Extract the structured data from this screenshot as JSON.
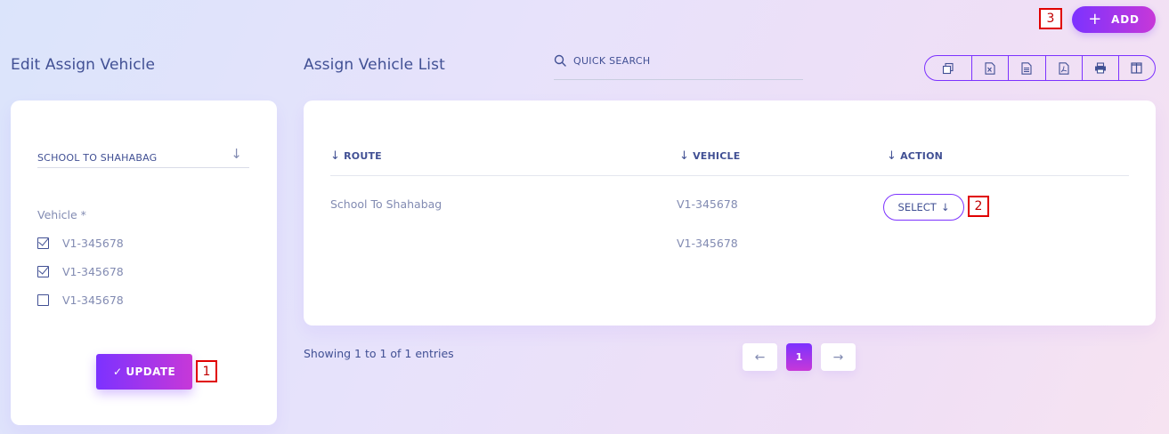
{
  "header": {
    "add_label": "ADD",
    "add_icon": "plus-icon",
    "marker_add": "3"
  },
  "left_panel": {
    "title": "Edit Assign Vehicle",
    "route_value": "SCHOOL TO SHAHABAG",
    "vehicle_label": "Vehicle *",
    "vehicles": [
      {
        "label": "V1-345678",
        "checked": true
      },
      {
        "label": "V1-345678",
        "checked": true
      },
      {
        "label": "V1-345678",
        "checked": false
      }
    ],
    "update_label": "UPDATE",
    "marker_update": "1"
  },
  "list": {
    "title": "Assign Vehicle List",
    "search_placeholder": "QUICK SEARCH",
    "toolbar_icons": [
      "copy-icon",
      "excel-icon",
      "csv-icon",
      "pdf-icon",
      "print-icon",
      "columns-icon"
    ],
    "columns": [
      "ROUTE",
      "VEHICLE",
      "ACTION"
    ],
    "rows": [
      {
        "route": "School To Shahabag",
        "vehicles": [
          "V1-345678",
          "V1-345678"
        ],
        "action": "SELECT"
      }
    ],
    "marker_select": "2",
    "info": "Showing 1 to 1 of 1 entries",
    "pagination": {
      "prev": "←",
      "current": "1",
      "next": "→"
    }
  },
  "colors": {
    "accent": "#7c32ff",
    "accent_end": "#c738d8",
    "text_primary": "#415094",
    "text_muted": "#828bb2",
    "marker": "#e00000"
  }
}
